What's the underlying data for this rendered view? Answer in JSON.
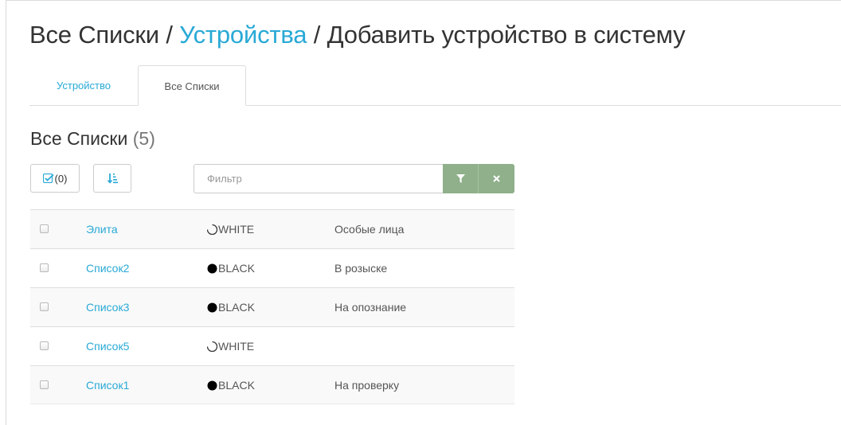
{
  "breadcrumb": {
    "root": "Все Списки",
    "separator1": "/",
    "middle": "Устройства",
    "separator2": "/",
    "current": "Добавить устройство в систему"
  },
  "tabs": [
    {
      "label": "Устройство",
      "active": false
    },
    {
      "label": "Все Списки",
      "active": true
    }
  ],
  "section": {
    "title": "Все Списки",
    "count": "(5)"
  },
  "toolbar": {
    "select_count": "(0)",
    "filter_placeholder": "Фильтр",
    "filter_value": ""
  },
  "colors": {
    "accent": "#29a9d6",
    "filter_button": "#8fb08a"
  },
  "rows": [
    {
      "name": "Элита",
      "type": "WHITE",
      "dot": "half-circle-icon",
      "description": "Особые лица"
    },
    {
      "name": "Список2",
      "type": "BLACK",
      "dot": "filled-circle-icon",
      "description": "В розыске"
    },
    {
      "name": "Список3",
      "type": "BLACK",
      "dot": "filled-circle-icon",
      "description": "На опознание"
    },
    {
      "name": "Список5",
      "type": "WHITE",
      "dot": "half-circle-icon",
      "description": ""
    },
    {
      "name": "Список1",
      "type": "BLACK",
      "dot": "filled-circle-icon",
      "description": "На проверку"
    }
  ]
}
